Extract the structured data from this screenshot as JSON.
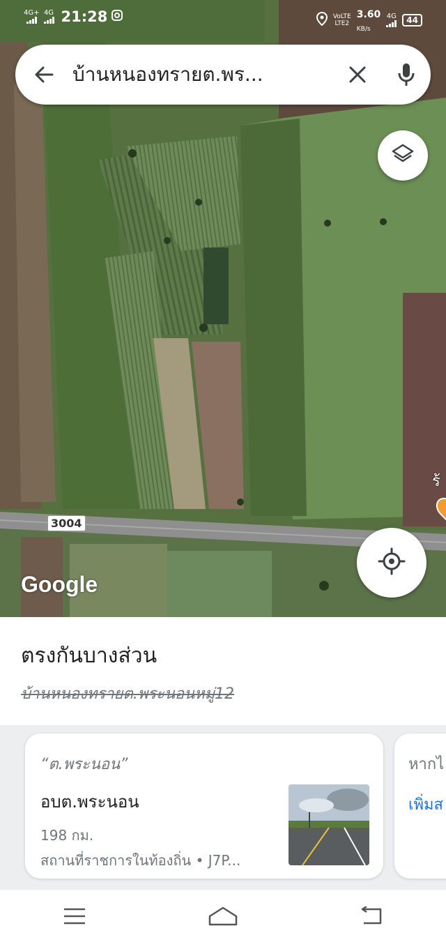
{
  "status_bar": {
    "sim1_network": "4G+",
    "sim2_network": "4G",
    "time": "21:28",
    "volte_label": "VoLTE",
    "lte_label": "LTE2",
    "net_speed": "3.60",
    "net_speed_unit": "KB/s",
    "data_network": "4G",
    "battery_level": "44"
  },
  "search": {
    "query": "บ้านหนองทรายต.พร..."
  },
  "map": {
    "road_number": "3004",
    "attribution": "Google",
    "place_label_partial": "ร้"
  },
  "result": {
    "title": "ตรงกันบางส่วน",
    "struck_query": "บ้านหนองทรายต.พระนอนหมู่12"
  },
  "cards": [
    {
      "matched_quote": "“ต.พระนอน”",
      "name": "อบต.พระนอน",
      "distance": "198 กม.",
      "category_and_code": "สถานที่ราชการในท้องถิ่น • J7P..."
    },
    {
      "partial_query": "หากไ",
      "partial_link": "เพิ่มส"
    }
  ],
  "icons": {
    "back": "arrow-left-icon",
    "clear": "close-icon",
    "mic": "microphone-icon",
    "layers": "layers-icon",
    "locate": "my-location-icon",
    "nav_menu": "menu-icon",
    "nav_home": "home-icon",
    "nav_back": "back-icon"
  },
  "colors": {
    "link": "#1a73e8",
    "pin": "#f39b32"
  }
}
